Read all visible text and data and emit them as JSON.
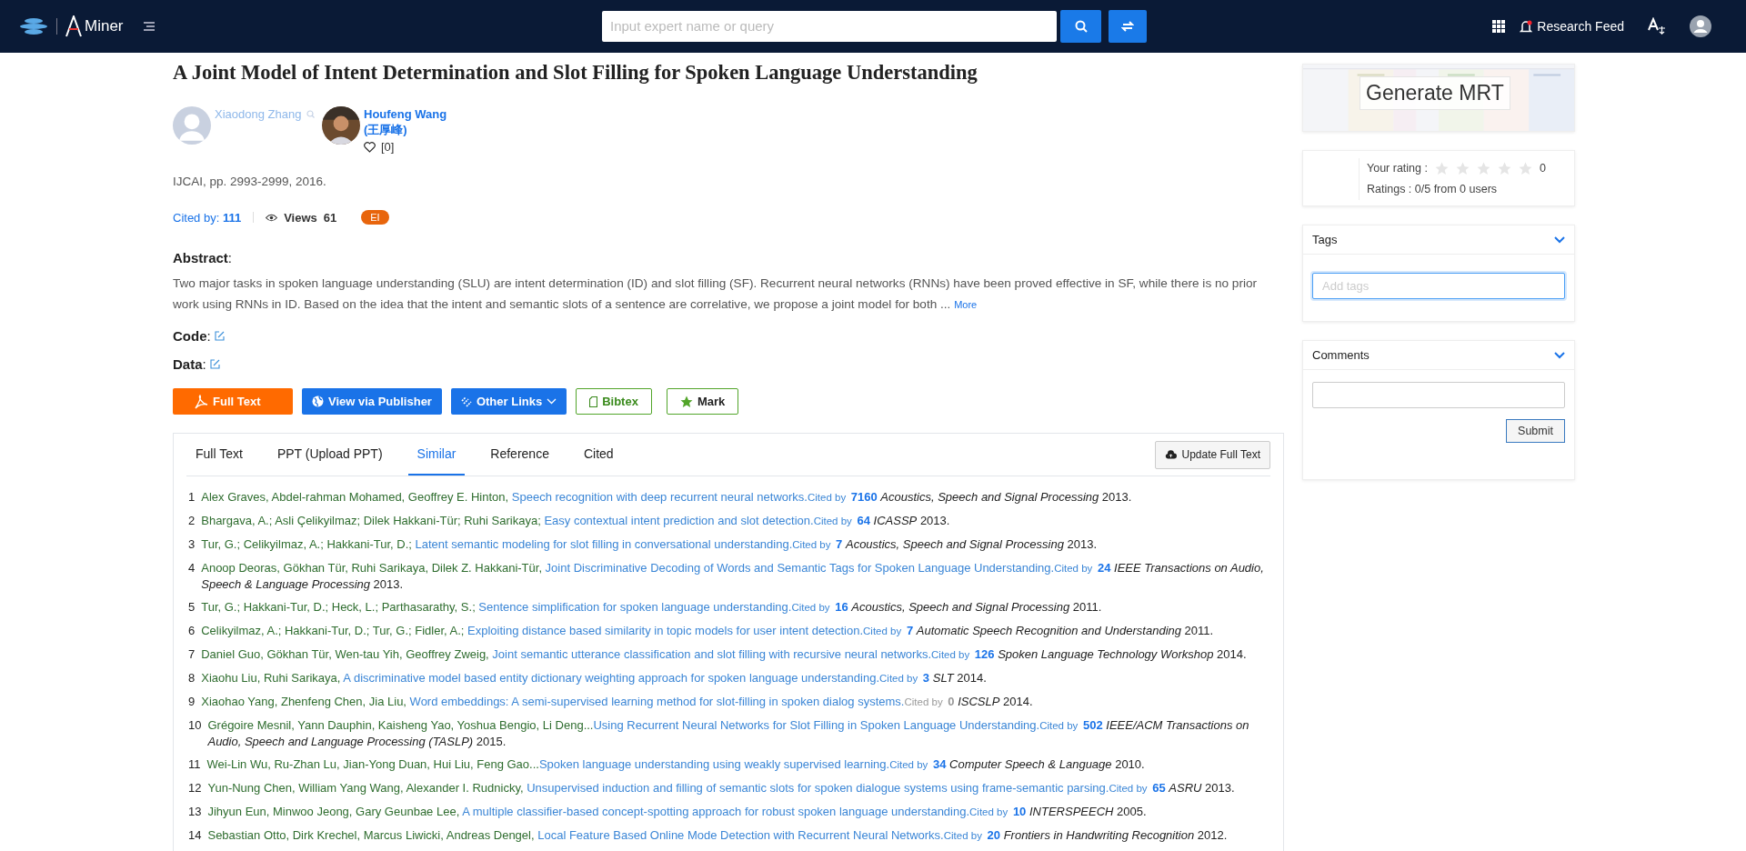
{
  "header": {
    "brand": "Miner",
    "search": {
      "placeholder": "Input expert name or query"
    },
    "research_feed": "Research Feed",
    "notification_dot": true
  },
  "paper": {
    "title": "A Joint Model of Intent Determination and Slot Filling for Spoken Language Understanding",
    "authors": [
      {
        "name": "Xiaodong Zhang",
        "has_photo": false,
        "linked": false
      },
      {
        "name": "Houfeng Wang",
        "native_name": "(王厚峰)",
        "likes": "[0]",
        "has_photo": true,
        "linked": true
      }
    ],
    "venue": "IJCAI, pp. 2993-2999, 2016.",
    "cited_label": "Cited by:",
    "cited_count": "111",
    "views_label": "Views",
    "views": "61",
    "badge": "EI",
    "abstract_label": "**Abstract**:",
    "abstract": "Two major tasks in spoken language understanding (SLU) are intent determination (ID) and slot filling (SF). Recurrent neural networks (RNNs) have been proved effective in SF, while there is no prior work using RNNs in ID. Based on the idea that the intent and semantic slots of a sentence are correlative, we propose a joint model for both ...",
    "more": "More",
    "fields": [
      {
        "label": "**Code**:"
      },
      {
        "label": "**Data**:"
      }
    ],
    "actions": [
      {
        "kind": "pdf",
        "label": "Full Text"
      },
      {
        "kind": "publisher",
        "label": "View via Publisher"
      },
      {
        "kind": "links",
        "label": "Other Links"
      },
      {
        "kind": "bibtex",
        "label": "Bibtex"
      },
      {
        "kind": "mark",
        "label": "Mark"
      }
    ]
  },
  "tabs": [
    {
      "label": "Full Text",
      "selected": false
    },
    {
      "label": "PPT (Upload PPT)",
      "selected": false
    },
    {
      "label": "Similar",
      "selected": true
    },
    {
      "label": "Reference",
      "selected": false
    },
    {
      "label": "Cited",
      "selected": false
    }
  ],
  "update_button": "Update Full Text",
  "references": [
    {
      "num": "1",
      "authors": "Alex Graves, Abdel-rahman Mohamed, Geoffrey E. Hinton, ",
      "title": "Speech recognition with deep recurrent neural networks.",
      "cited_label": "Cited by",
      "count": "7160",
      "has_citations": true,
      "source": "*Acoustics, Speech and Signal Processing* 2013."
    },
    {
      "num": "2",
      "authors": "Bhargava, A.; Asli Çelikyilmaz; Dilek Hakkani-Tür; Ruhi Sarikaya; ",
      "title": "Easy contextual intent prediction and slot detection.",
      "cited_label": "Cited by",
      "count": "64",
      "has_citations": true,
      "source": "*ICASSP* 2013."
    },
    {
      "num": "3",
      "authors": "Tur, G.; Celikyilmaz, A.; Hakkani-Tur, D.; ",
      "title": "Latent semantic modeling for slot filling in conversational understanding.",
      "cited_label": "Cited by",
      "count": "7",
      "has_citations": true,
      "source": "*Acoustics, Speech and Signal Processing* 2013."
    },
    {
      "num": "4",
      "authors": "Anoop Deoras, Gökhan Tür, Ruhi Sarikaya, Dilek Z. Hakkani-Tür, ",
      "title": "Joint Discriminative Decoding of Words and Semantic Tags for Spoken Language Understanding.",
      "cited_label": "Cited by",
      "count": "24",
      "has_citations": true,
      "source": "*IEEE Transactions on Audio, Speech & Language Processing* 2013."
    },
    {
      "num": "5",
      "authors": "Tur, G.; Hakkani-Tur, D.; Heck, L.; Parthasarathy, S.; ",
      "title": "Sentence simplification for spoken language understanding.",
      "cited_label": "Cited by",
      "count": "16",
      "has_citations": true,
      "source": "*Acoustics, Speech and Signal Processing* 2011."
    },
    {
      "num": "6",
      "authors": "Celikyilmaz, A.; Hakkani-Tur, D.; Tur, G.; Fidler, A.; ",
      "title": "Exploiting distance based similarity in topic models for user intent detection.",
      "cited_label": "Cited by",
      "count": "7",
      "has_citations": true,
      "source": "*Automatic Speech Recognition and Understanding* 2011."
    },
    {
      "num": "7",
      "authors": "Daniel Guo, Gökhan Tür, Wen-tau Yih, Geoffrey Zweig, ",
      "title": "Joint semantic utterance classification and slot filling with recursive neural networks.",
      "cited_label": "Cited by",
      "count": "126",
      "has_citations": true,
      "source": "*Spoken Language Technology Workshop* 2014."
    },
    {
      "num": "8",
      "authors": "Xiaohu Liu, Ruhi Sarikaya, ",
      "title": "A discriminative model based entity dictionary weighting approach for spoken language understanding.",
      "cited_label": "Cited by",
      "count": "3",
      "has_citations": true,
      "source": "*SLT* 2014."
    },
    {
      "num": "9",
      "authors": "Xiaohao Yang, Zhenfeng Chen, Jia Liu, ",
      "title": "Word embeddings: A semi-supervised learning method for slot-filling in spoken dialog systems.",
      "cited_label": "Cited by",
      "count": "0",
      "has_citations": false,
      "source": "*ISCSLP* 2014."
    },
    {
      "num": "10",
      "authors": "Grégoire Mesnil, Yann Dauphin, Kaisheng Yao, Yoshua Bengio, Li Deng...",
      "title": "Using Recurrent Neural Networks for Slot Filling in Spoken Language Understanding.",
      "cited_label": "Cited by",
      "count": "502",
      "has_citations": true,
      "source": "*IEEE/ACM Transactions on Audio, Speech and Language Processing (TASLP)* 2015."
    },
    {
      "num": "11",
      "authors": "Wei-Lin Wu, Ru-Zhan Lu, Jian-Yong Duan, Hui Liu, Feng Gao...",
      "title": "Spoken language understanding using weakly supervised learning.",
      "cited_label": "Cited by",
      "count": "34",
      "has_citations": true,
      "source": "*Computer Speech & Language* 2010."
    },
    {
      "num": "12",
      "authors": "Yun-Nung Chen, William Yang Wang, Alexander I. Rudnicky, ",
      "title": "Unsupervised induction and filling of semantic slots for spoken dialogue systems using frame-semantic parsing.",
      "cited_label": "Cited by",
      "count": "65",
      "has_citations": true,
      "source": "*ASRU* 2013."
    },
    {
      "num": "13",
      "authors": "Jihyun Eun, Minwoo Jeong, Gary Geunbae Lee, ",
      "title": "A multiple classifier-based concept-spotting approach for robust spoken language understanding.",
      "cited_label": "Cited by",
      "count": "10",
      "has_citations": true,
      "source": "*INTERSPEECH* 2005."
    },
    {
      "num": "14",
      "authors": "Sebastian Otto, Dirk Krechel, Marcus Liwicki, Andreas Dengel, ",
      "title": "Local Feature Based Online Mode Detection with Recurrent Neural Networks.",
      "cited_label": "Cited by",
      "count": "20",
      "has_citations": true,
      "source": "*Frontiers in Handwriting Recognition* 2012."
    }
  ],
  "sidebar": {
    "mrt_button": "Generate MRT",
    "rating": {
      "your_label": "Your rating :",
      "stars": 0,
      "value": "0",
      "summary": "Ratings : 0/5 from 0 users"
    },
    "tags": {
      "title": "Tags",
      "expanded": true,
      "placeholder": "Add tags"
    },
    "comments": {
      "title": "Comments",
      "expanded": true,
      "submit": "Submit"
    }
  }
}
